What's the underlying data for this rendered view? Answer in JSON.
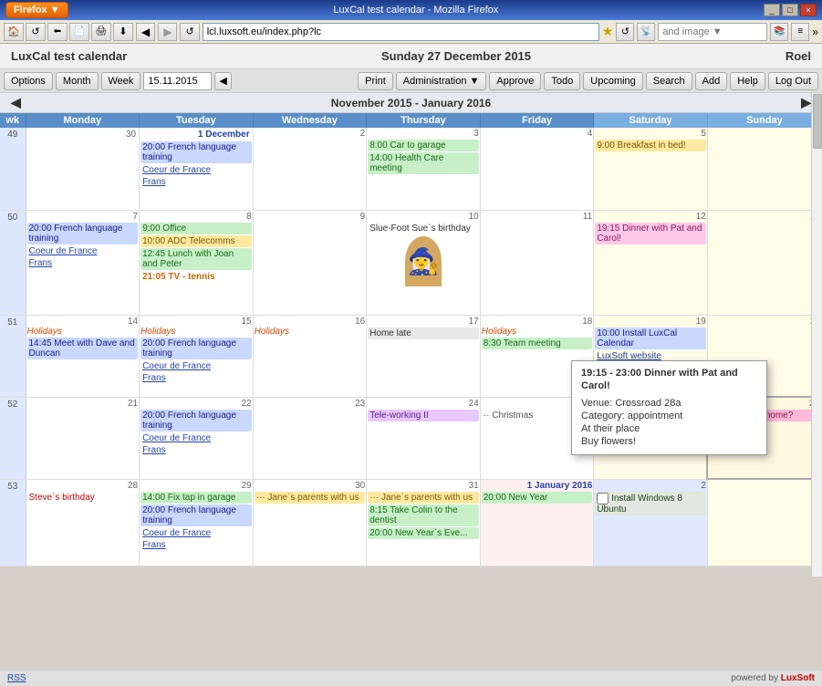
{
  "titlebar": {
    "title": "Firefox",
    "controls": [
      "_",
      "□",
      "×"
    ]
  },
  "browser": {
    "address": "lcl.luxsoft.eu/index.php?lc",
    "nav_buttons": [
      "←",
      "→",
      "↺"
    ]
  },
  "app": {
    "title": "LuxCal test calendar",
    "date": "Sunday 27 December 2015",
    "user": "Roel"
  },
  "nav": {
    "options": "Options",
    "month": "Month",
    "week": "Week",
    "date_input": "15.11.2015",
    "print": "Print",
    "administration": "Administration",
    "approve": "Approve",
    "todo": "Todo",
    "upcoming": "Upcoming",
    "search": "Search",
    "add": "Add",
    "help": "Help",
    "logout": "Log Out"
  },
  "calendar": {
    "title": "November 2015 - January 2016",
    "headers": [
      "wk",
      "Monday",
      "Tuesday",
      "Wednesday",
      "Thursday",
      "Friday",
      "Saturday",
      "Sunday"
    ],
    "weeks": [
      "49",
      "50",
      "51",
      "52",
      "53"
    ]
  },
  "tooltip": {
    "title": "19:15 - 23:00 Dinner with Pat and Carol!",
    "venue": "Venue: Crossroad 28a",
    "category": "Category: appointment",
    "location": "At their place",
    "note": "Buy flowers!"
  },
  "statusbar": {
    "rss": "RSS",
    "powered": "powered by",
    "brand": "LuxSoft"
  }
}
